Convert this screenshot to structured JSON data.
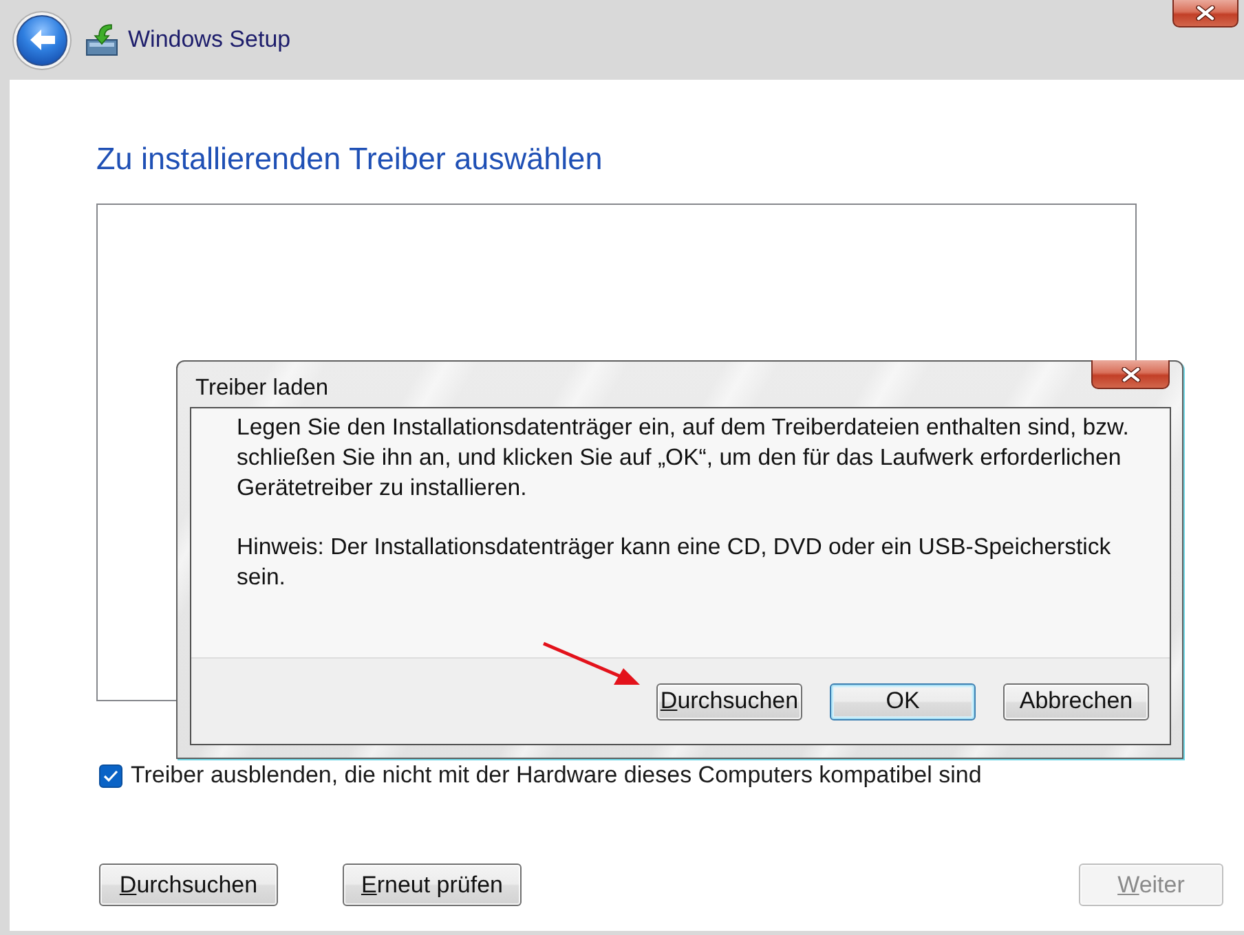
{
  "window": {
    "title": "Windows Setup"
  },
  "page": {
    "heading": "Zu installierenden Treiber auswählen"
  },
  "hide_incompatible": {
    "label": "Treiber ausblenden, die nicht mit der Hardware dieses Computers kompatibel sind",
    "checked": true
  },
  "buttons": [
    {
      "label": "Durchsuchen",
      "access_key_shown": true,
      "disabled": false
    },
    {
      "label": "Erneut prüfen",
      "access_key_shown": true,
      "disabled": false
    }
  ],
  "nav_buttons": [
    {
      "label": "Weiter",
      "access_key_shown": true,
      "disabled": true
    }
  ],
  "dialog": {
    "title": "Treiber laden",
    "paragraphs": [
      "Legen Sie den Installationsdatenträger ein, auf dem Treiberdateien enthalten sind, bzw. schließen Sie ihn an, und klicken Sie auf „OK“, um den für das Laufwerk erforderlichen Gerätetreiber zu installieren.",
      "Hinweis: Der Installationsdatenträger kann eine CD, DVD oder ein USB-Speicherstick sein."
    ],
    "buttons": [
      {
        "label": "Durchsuchen",
        "access_key_shown": true,
        "default": false
      },
      {
        "label": "OK",
        "access_key_shown": false,
        "default": true
      },
      {
        "label": "Abbrechen",
        "access_key_shown": false,
        "default": false
      }
    ]
  },
  "annotations": [
    {
      "kind": "arrow"
    }
  ]
}
